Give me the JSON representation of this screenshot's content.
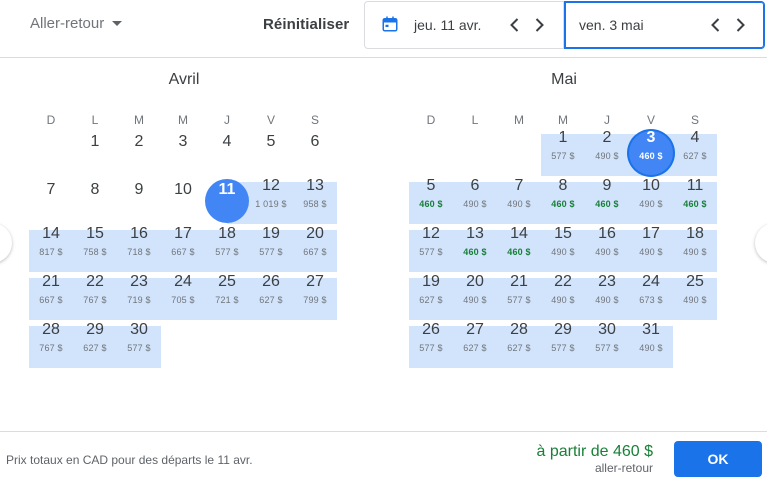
{
  "header": {
    "trip_type": "Aller-retour",
    "reset_label": "Réinitialiser",
    "departure_date": "jeu. 11 avr.",
    "return_date": "ven. 3 mai"
  },
  "colors": {
    "accent": "#1a73e8",
    "selected_circle": "#4285f4",
    "range_band": "#d2e3fc",
    "cheap_price": "#188038"
  },
  "icons": {
    "calendar": "calendar-icon",
    "prev": "chevron-left-icon",
    "next": "chevron-right-icon",
    "dropdown": "caret-down-icon"
  },
  "weekdays": [
    "D",
    "L",
    "M",
    "M",
    "J",
    "V",
    "S"
  ],
  "months": [
    {
      "title": "Avril",
      "first_weekday": 1,
      "days": [
        {
          "d": "1"
        },
        {
          "d": "2"
        },
        {
          "d": "3"
        },
        {
          "d": "4"
        },
        {
          "d": "5"
        },
        {
          "d": "6"
        },
        {
          "d": "7"
        },
        {
          "d": "8"
        },
        {
          "d": "9"
        },
        {
          "d": "10"
        },
        {
          "d": "11",
          "state": "selected-start"
        },
        {
          "d": "12",
          "p": "1 019 $"
        },
        {
          "d": "13",
          "p": "958 $"
        },
        {
          "d": "14",
          "p": "817 $"
        },
        {
          "d": "15",
          "p": "758 $"
        },
        {
          "d": "16",
          "p": "718 $"
        },
        {
          "d": "17",
          "p": "667 $"
        },
        {
          "d": "18",
          "p": "577 $"
        },
        {
          "d": "19",
          "p": "577 $"
        },
        {
          "d": "20",
          "p": "667 $"
        },
        {
          "d": "21",
          "p": "667 $"
        },
        {
          "d": "22",
          "p": "767 $"
        },
        {
          "d": "23",
          "p": "719 $"
        },
        {
          "d": "24",
          "p": "705 $"
        },
        {
          "d": "25",
          "p": "721 $"
        },
        {
          "d": "26",
          "p": "627 $"
        },
        {
          "d": "27",
          "p": "799 $"
        },
        {
          "d": "28",
          "p": "767 $"
        },
        {
          "d": "29",
          "p": "627 $"
        },
        {
          "d": "30",
          "p": "577 $"
        }
      ]
    },
    {
      "title": "Mai",
      "first_weekday": 3,
      "days": [
        {
          "d": "1",
          "p": "577 $"
        },
        {
          "d": "2",
          "p": "490 $"
        },
        {
          "d": "3",
          "p": "460 $",
          "state": "selected-end"
        },
        {
          "d": "4",
          "p": "627 $"
        },
        {
          "d": "5",
          "p": "460 $",
          "g": true
        },
        {
          "d": "6",
          "p": "490 $"
        },
        {
          "d": "7",
          "p": "490 $"
        },
        {
          "d": "8",
          "p": "460 $",
          "g": true
        },
        {
          "d": "9",
          "p": "460 $",
          "g": true
        },
        {
          "d": "10",
          "p": "490 $"
        },
        {
          "d": "11",
          "p": "460 $",
          "g": true
        },
        {
          "d": "12",
          "p": "577 $"
        },
        {
          "d": "13",
          "p": "460 $",
          "g": true
        },
        {
          "d": "14",
          "p": "460 $",
          "g": true
        },
        {
          "d": "15",
          "p": "490 $"
        },
        {
          "d": "16",
          "p": "490 $"
        },
        {
          "d": "17",
          "p": "490 $"
        },
        {
          "d": "18",
          "p": "490 $"
        },
        {
          "d": "19",
          "p": "627 $"
        },
        {
          "d": "20",
          "p": "490 $"
        },
        {
          "d": "21",
          "p": "577 $"
        },
        {
          "d": "22",
          "p": "490 $"
        },
        {
          "d": "23",
          "p": "490 $"
        },
        {
          "d": "24",
          "p": "673 $"
        },
        {
          "d": "25",
          "p": "490 $"
        },
        {
          "d": "26",
          "p": "577 $"
        },
        {
          "d": "27",
          "p": "627 $"
        },
        {
          "d": "28",
          "p": "627 $"
        },
        {
          "d": "29",
          "p": "577 $"
        },
        {
          "d": "30",
          "p": "577 $"
        },
        {
          "d": "31",
          "p": "490 $"
        }
      ]
    }
  ],
  "footer": {
    "note": "Prix totaux en CAD pour des départs le 11 avr.",
    "from_price": "à partir de 460 $",
    "trip_label": "aller-retour",
    "ok_label": "OK"
  }
}
